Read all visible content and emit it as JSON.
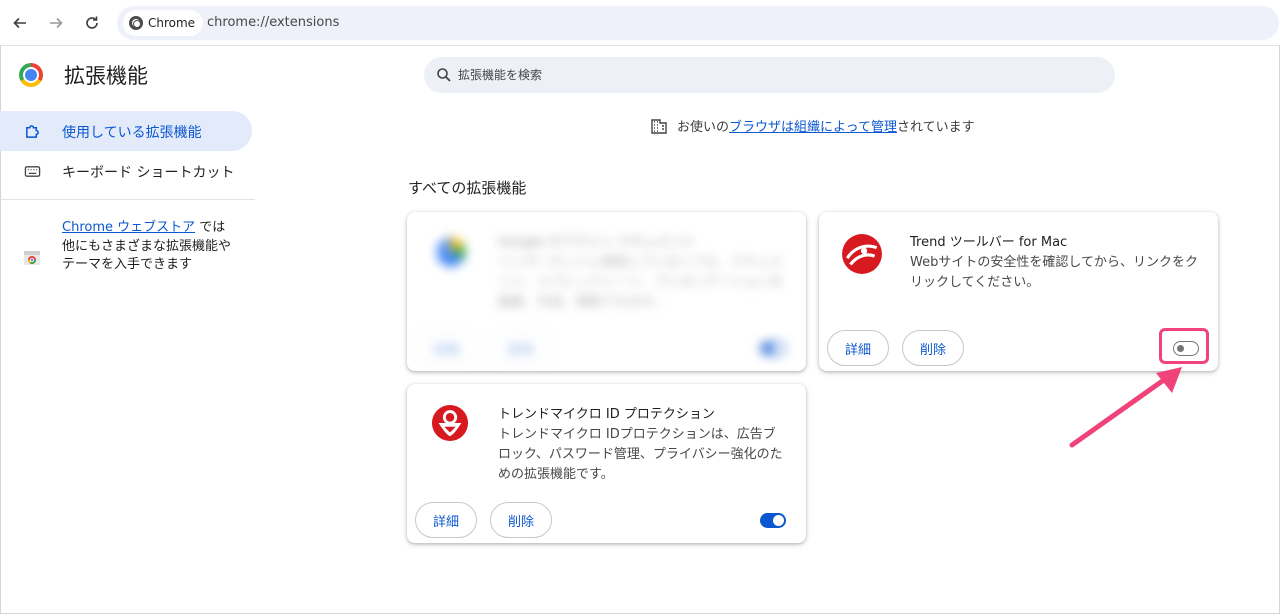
{
  "browser": {
    "chip_label": "Chrome",
    "url": "chrome://extensions"
  },
  "header": {
    "title": "拡張機能",
    "search_placeholder": "拡張機能を検索"
  },
  "sidebar": {
    "items": [
      {
        "label": "使用している拡張機能",
        "icon": "puzzle-icon",
        "active": true
      },
      {
        "label": "キーボード ショートカット",
        "icon": "keyboard-icon",
        "active": false
      }
    ],
    "store_link": "Chrome ウェブストア",
    "store_text": " では他にもさまざまな拡張機能やテーマを入手できます"
  },
  "managed_notice": {
    "prefix": "お使いの",
    "link": "ブラウザは組織によって管理",
    "suffix": "されています"
  },
  "section_title": "すべての拡張機能",
  "extensions": [
    {
      "name": "Google オフライン ドキュメント",
      "description": "インターネットに接続していなくても、ドキュメント、スプレッドシート、プレゼンテーションを編集、作成、閲覧できます。",
      "details_label": "詳細",
      "remove_label": "削除",
      "enabled": true,
      "blurred": true
    },
    {
      "name": "Trend ツールバー for Mac",
      "description": "Webサイトの安全性を確認してから、リンクをクリックしてください。",
      "details_label": "詳細",
      "remove_label": "削除",
      "enabled": false,
      "highlighted": true,
      "icon": "trend-micro-icon",
      "icon_color": "#d71920"
    },
    {
      "name": "トレンドマイクロ ID プロテクション",
      "description": "トレンドマイクロ IDプロテクションは、広告ブロック、パスワード管理、プライバシー強化のための拡張機能です。",
      "details_label": "詳細",
      "remove_label": "削除",
      "enabled": true,
      "icon": "id-protection-icon",
      "icon_color": "#d71920"
    }
  ],
  "colors": {
    "accent": "#0b57d0",
    "annotation": "#f0437a"
  }
}
